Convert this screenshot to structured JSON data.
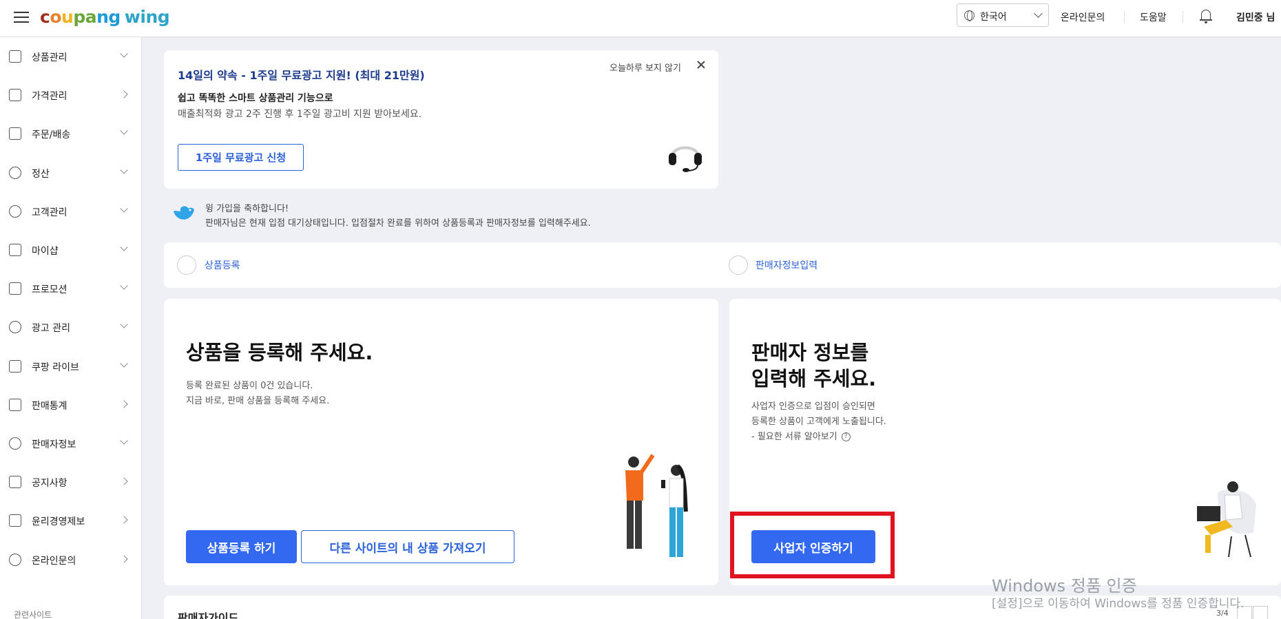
{
  "header": {
    "logo": {
      "c1": "c",
      "c2": "o",
      "c3": "u",
      "c4": "pa",
      "c5": "ng",
      "wing": "wing"
    },
    "language": "한국어",
    "links": {
      "inquiry": "온라인문의",
      "help": "도움말"
    },
    "username": "김민중 님"
  },
  "sidebar": {
    "items": [
      {
        "label": "상품관리",
        "icon": "box-icon",
        "arrow": "down"
      },
      {
        "label": "가격관리",
        "icon": "medal-icon",
        "arrow": "right"
      },
      {
        "label": "주문/배송",
        "icon": "truck-icon",
        "arrow": "down"
      },
      {
        "label": "정산",
        "icon": "won-icon",
        "arrow": "down"
      },
      {
        "label": "고객관리",
        "icon": "smile-icon",
        "arrow": "down"
      },
      {
        "label": "마이샵",
        "icon": "shop-icon",
        "arrow": "down"
      },
      {
        "label": "프로모션",
        "icon": "coupon-icon",
        "arrow": "down"
      },
      {
        "label": "광고 관리",
        "icon": "pie-icon",
        "arrow": "down"
      },
      {
        "label": "쿠팡 라이브",
        "icon": "live-icon",
        "arrow": "down"
      },
      {
        "label": "판매통계",
        "icon": "bar-chart-icon",
        "arrow": "right"
      },
      {
        "label": "판매자정보",
        "icon": "user-icon",
        "arrow": "down"
      },
      {
        "label": "공지사항",
        "icon": "megaphone-icon",
        "arrow": "right"
      },
      {
        "label": "윤리경영제보",
        "icon": "siren-icon",
        "arrow": "right"
      },
      {
        "label": "온라인문의",
        "icon": "headset-icon",
        "arrow": "right"
      }
    ],
    "related": "관련사이트"
  },
  "promo": {
    "title": "14일의 약속 - 1주일 무료광고 지원! (최대 21만원)",
    "subtitle": "쉽고 똑똑한 스마트 상품관리 기능으로",
    "description": "매출최적화 광고 2주 진행 후 1주일 광고비 지원 받아보세요.",
    "button": "1주일 무료광고 신청",
    "hide_today": "오늘하루 보지 않기"
  },
  "welcome": {
    "line1": "윙 가입을 축하합니다!",
    "line2": "판매자님은 현재 입점 대기상태입니다. 입점절차 완료를 위하여 상품등록과 판매자정보를 입력해주세요."
  },
  "steps": [
    {
      "label": "상품등록"
    },
    {
      "label": "판매자정보입력"
    }
  ],
  "product_card": {
    "heading": "상품을 등록해 주세요.",
    "line1": "등록 완료된 상품이 0건 있습니다.",
    "line2": "지금 바로, 판매 상품을 등록해 주세요.",
    "primary_button": "상품등록 하기",
    "secondary_button": "다른 사이트의 내 상품 가져오기"
  },
  "seller_card": {
    "heading1": "판매자 정보를",
    "heading2": "입력해 주세요.",
    "line1": "사업자 인증으로 입점이 승인되면",
    "line2": "등록한 상품이 고객에게 노출됩니다.",
    "line3": "- 필요한 서류 알아보기",
    "help_mark": "?",
    "button": "사업자 인증하기"
  },
  "guide": {
    "title": "판매자가이드",
    "pager": "3/4"
  },
  "watermark": {
    "line1": "Windows 정품 인증",
    "line2": "[설정]으로 이동하여 Windows를 정품 인증합니다."
  },
  "colors": {
    "accent": "#3369f0",
    "highlight": "#e0141e",
    "navy": "#1d3b8c"
  }
}
